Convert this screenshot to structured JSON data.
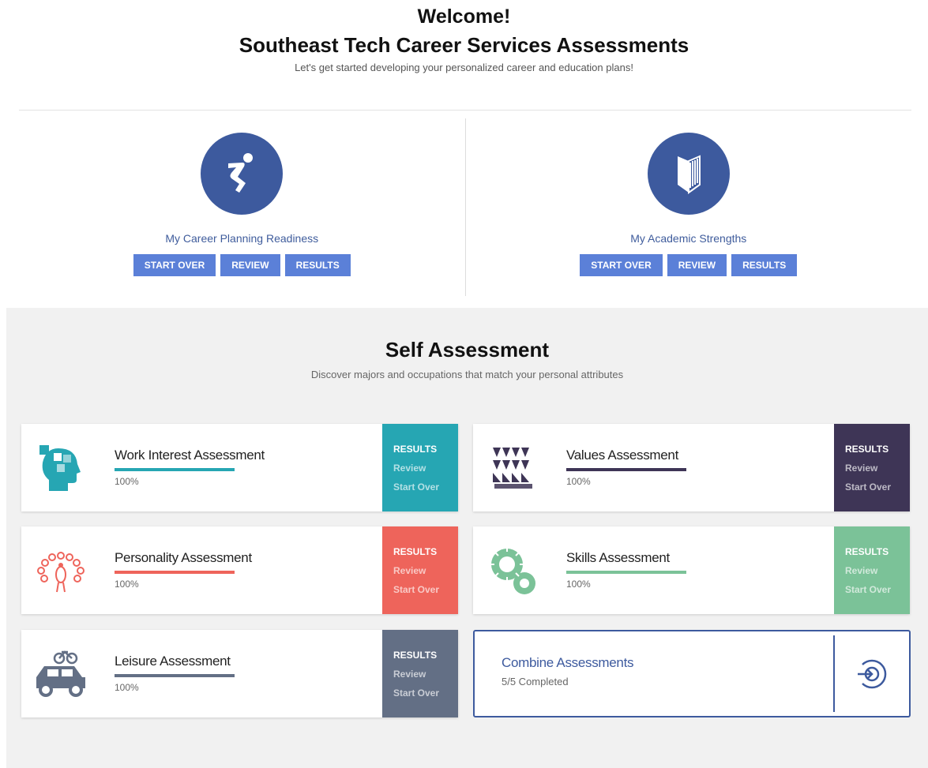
{
  "header": {
    "welcome": "Welcome!",
    "title": "Southeast Tech Career Services Assessments",
    "subtitle": "Let's get started developing your personalized career and education plans!"
  },
  "top_cards": [
    {
      "title": "My Career Planning Readiness",
      "icon": "running-figure-icon",
      "buttons": [
        "START OVER",
        "REVIEW",
        "RESULTS"
      ]
    },
    {
      "title": "My Academic Strengths",
      "icon": "book-icon",
      "buttons": [
        "START OVER",
        "REVIEW",
        "RESULTS"
      ]
    }
  ],
  "self_assessment": {
    "title": "Self Assessment",
    "subtitle": "Discover majors and occupations that match your personal attributes",
    "cards": [
      {
        "title": "Work Interest Assessment",
        "progress": "100%",
        "progress_value": 1.0,
        "color": "#26a6b3",
        "icon": "puzzle-head-icon",
        "actions": [
          "RESULTS",
          "Review",
          "Start Over"
        ]
      },
      {
        "title": "Values Assessment",
        "progress": "100%",
        "progress_value": 1.0,
        "color": "#3e3556",
        "icon": "triangles-pattern-icon",
        "actions": [
          "RESULTS",
          "Review",
          "Start Over"
        ]
      },
      {
        "title": "Personality Assessment",
        "progress": "100%",
        "progress_value": 1.0,
        "color": "#ee645b",
        "icon": "peacock-icon",
        "actions": [
          "RESULTS",
          "Review",
          "Start Over"
        ]
      },
      {
        "title": "Skills Assessment",
        "progress": "100%",
        "progress_value": 1.0,
        "color": "#7bc298",
        "icon": "gears-icon",
        "actions": [
          "RESULTS",
          "Review",
          "Start Over"
        ]
      },
      {
        "title": "Leisure Assessment",
        "progress": "100%",
        "progress_value": 1.0,
        "color": "#636f85",
        "icon": "car-bike-icon",
        "actions": [
          "RESULTS",
          "Review",
          "Start Over"
        ]
      }
    ],
    "combine": {
      "title": "Combine Assessments",
      "status": "5/5 Completed",
      "icon": "enter-circle-icon",
      "color": "#3d5a9e"
    }
  }
}
